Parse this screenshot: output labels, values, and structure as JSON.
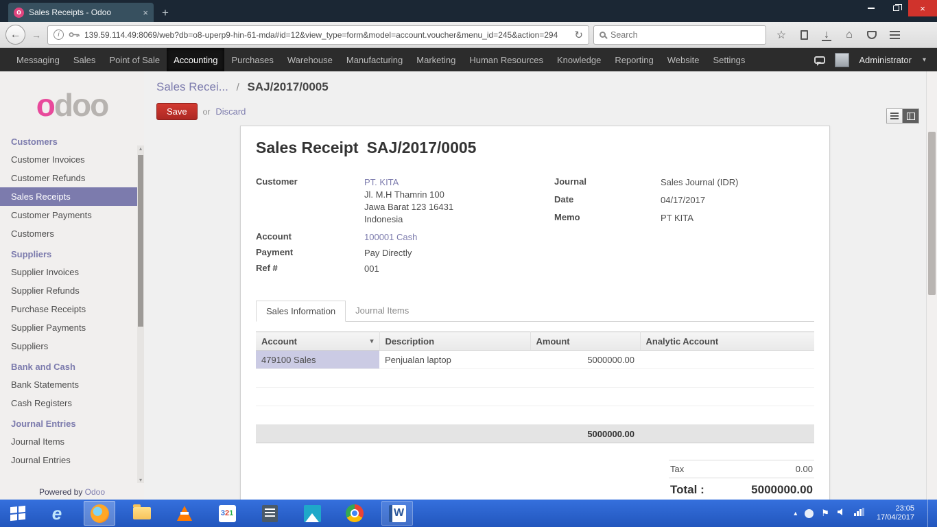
{
  "browser": {
    "tab_title": "Sales Receipts - Odoo",
    "url": "139.59.114.49:8069/web?db=o8-uperp9-hin-61-mda#id=12&view_type=form&model=account.voucher&menu_id=245&action=294",
    "search_placeholder": "Search"
  },
  "icons": {
    "favicon_letter": "o",
    "close": "×",
    "new_tab": "+",
    "back": "←",
    "forward": "→",
    "reload": "↻",
    "info": "i",
    "star": "☆",
    "download": "↓",
    "home": "⌂",
    "caret_down": "▾",
    "caret_up": "▴",
    "flag": "⚑"
  },
  "odoo_nav": {
    "items": [
      "Messaging",
      "Sales",
      "Point of Sale",
      "Accounting",
      "Purchases",
      "Warehouse",
      "Manufacturing",
      "Marketing",
      "Human Resources",
      "Knowledge",
      "Reporting",
      "Website",
      "Settings"
    ],
    "active": "Accounting",
    "user": "Administrator"
  },
  "sidebar": {
    "logo_first": "o",
    "logo_rest": "doo",
    "sections": [
      {
        "title": "Customers",
        "items": [
          "Customer Invoices",
          "Customer Refunds",
          "Sales Receipts",
          "Customer Payments",
          "Customers"
        ],
        "active": "Sales Receipts"
      },
      {
        "title": "Suppliers",
        "items": [
          "Supplier Invoices",
          "Supplier Refunds",
          "Purchase Receipts",
          "Supplier Payments",
          "Suppliers"
        ]
      },
      {
        "title": "Bank and Cash",
        "items": [
          "Bank Statements",
          "Cash Registers"
        ]
      },
      {
        "title": "Journal Entries",
        "items": [
          "Journal Items",
          "Journal Entries"
        ]
      }
    ],
    "powered_by": "Powered by",
    "powered_brand": "Odoo"
  },
  "breadcrumb": {
    "parent": "Sales Recei...",
    "separator": "/",
    "current": "SAJ/2017/0005"
  },
  "actions": {
    "save": "Save",
    "or": "or",
    "discard": "Discard"
  },
  "form": {
    "title": "Sales Receipt",
    "title_ref": "SAJ/2017/0005",
    "fields": {
      "customer_label": "Customer",
      "customer_name": "PT. KITA",
      "customer_address": [
        "Jl. M.H Thamrin 100",
        "Jawa Barat 123 16431",
        "Indonesia"
      ],
      "account_label": "Account",
      "account_value": "100001 Cash",
      "payment_label": "Payment",
      "payment_value": "Pay Directly",
      "ref_label": "Ref #",
      "ref_value": "001",
      "journal_label": "Journal",
      "journal_value": "Sales Journal (IDR)",
      "date_label": "Date",
      "date_value": "04/17/2017",
      "memo_label": "Memo",
      "memo_value": "PT KITA"
    },
    "tabs": [
      {
        "label": "Sales Information",
        "active": true
      },
      {
        "label": "Journal Items",
        "active": false
      }
    ],
    "table": {
      "headers": [
        "Account",
        "Description",
        "Amount",
        "Analytic Account"
      ],
      "rows": [
        {
          "account": "479100 Sales",
          "description": "Penjualan laptop",
          "amount": "5000000.00",
          "analytic": ""
        }
      ],
      "total": "5000000.00"
    },
    "summary": {
      "tax_label": "Tax",
      "tax_value": "0.00",
      "total_label": "Total :",
      "total_value": "5000000.00"
    }
  },
  "taskbar": {
    "time": "23:05",
    "date": "17/04/2017"
  }
}
